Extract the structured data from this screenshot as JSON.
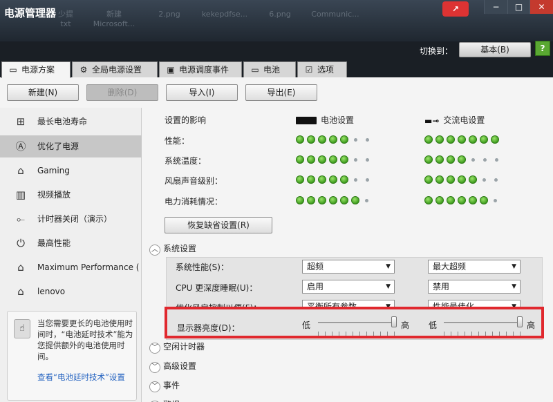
{
  "window": {
    "title": "电源管理器",
    "desktop_icons": [
      "少提\ntxt",
      "新建\nMicrosoft...",
      "2.png",
      "kekepdfse...",
      "6.png",
      "Communic..."
    ],
    "min_label": "−",
    "max_label": "□",
    "close_label": "✕"
  },
  "header": {
    "switch_label": "切换到：",
    "mode_button": "基本(B)",
    "help_label": "?"
  },
  "tabs": [
    {
      "label": "电源方案",
      "icon": "plan-icon"
    },
    {
      "label": "全局电源设置",
      "icon": "gear-icon"
    },
    {
      "label": "电源调度事件",
      "icon": "schedule-icon"
    },
    {
      "label": "电池",
      "icon": "battery-icon"
    },
    {
      "label": "选项",
      "icon": "checkbox-icon"
    }
  ],
  "toolbar": {
    "new": "新建(N)",
    "delete": "删除(D)",
    "import": "导入(I)",
    "export": "导出(E)"
  },
  "sidebar": {
    "items": [
      {
        "label": "最长电池寿命",
        "icon": "battery-plug-icon"
      },
      {
        "label": "优化了电源",
        "icon": "a-circle-icon"
      },
      {
        "label": "Gaming",
        "icon": "house-icon"
      },
      {
        "label": "视频播放",
        "icon": "film-icon"
      },
      {
        "label": "计时器关闭（演示）",
        "icon": "plug-icon"
      },
      {
        "label": "最高性能",
        "icon": "power-icon"
      },
      {
        "label": "Maximum Performance (",
        "icon": "house-icon"
      },
      {
        "label": "lenovo",
        "icon": "house-icon"
      }
    ],
    "selected_index": 1,
    "hint_text": "当您需要更长的电池使用时间时，“电池延时技术”能为您提供额外的电池使用时间。",
    "hint_link": "查看“电池延时技术”设置"
  },
  "impact": {
    "heading": "设置的影响",
    "battery_heading": "电池设置",
    "ac_heading": "交流电设置",
    "rows": [
      {
        "label": "性能：",
        "battery_on": 5,
        "battery_total": 7,
        "ac_on": 7,
        "ac_total": 7
      },
      {
        "label": "系统温度：",
        "battery_on": 5,
        "battery_total": 7,
        "ac_on": 4,
        "ac_total": 7
      },
      {
        "label": "风扇声音级别：",
        "battery_on": 5,
        "battery_total": 7,
        "ac_on": 5,
        "ac_total": 7
      },
      {
        "label": "电力消耗情况：",
        "battery_on": 6,
        "battery_total": 7,
        "ac_on": 6,
        "ac_total": 7
      }
    ],
    "restore_button": "恢复缺省设置(R)"
  },
  "system_settings": {
    "heading": "系统设置",
    "rows": [
      {
        "label": "系统性能(S)：",
        "battery": "超频",
        "ac": "最大超频"
      },
      {
        "label": "CPU 更深度睡眠(U)：",
        "battery": "启用",
        "ac": "禁用"
      },
      {
        "label": "优化风扇控制以便(F)：",
        "battery": "平衡所有参数",
        "ac": "性能最佳化"
      }
    ],
    "brightness": {
      "label": "显示器亮度(D)：",
      "low": "低",
      "high": "高",
      "battery_level": 1.0,
      "ac_level": 1.0
    }
  },
  "sections": [
    "空闲计时器",
    "高级设置",
    "事件",
    "警报"
  ]
}
